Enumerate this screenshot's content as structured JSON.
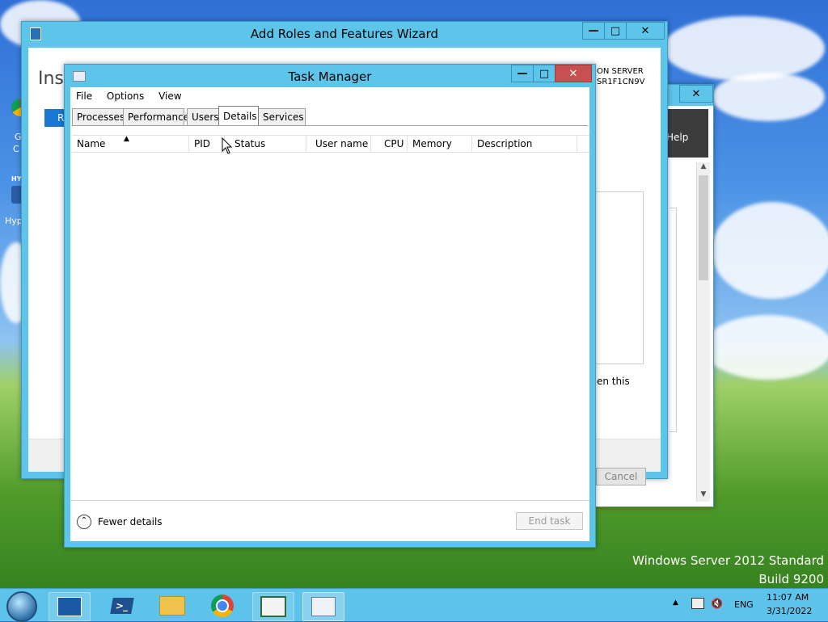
{
  "desktop": {
    "watermark_line1": "Windows Server 2012 Standard",
    "watermark_line2": "Build 9200",
    "icon_labels": [
      "G",
      "C",
      "HY",
      "Hyp"
    ]
  },
  "wizard": {
    "title": "Add Roles and Features Wizard",
    "heading_partial": "Ins",
    "side_button_partial": "R",
    "dest_server_line1": "ON SERVER",
    "dest_server_line2": "SR1F1CN9V",
    "footer_text_partial": "en this",
    "cancel_label": "Cancel",
    "ctl_min": "—",
    "ctl_max": "□",
    "ctl_close": "✕"
  },
  "help_window": {
    "help_label": "Help",
    "close_label": "✕"
  },
  "task_manager": {
    "title": "Task Manager",
    "menu": [
      "File",
      "Options",
      "View"
    ],
    "tabs": [
      "Processes",
      "Performance",
      "Users",
      "Details",
      "Services"
    ],
    "active_tab": "Details",
    "columns": [
      "Name",
      "PID",
      "Status",
      "User name",
      "CPU",
      "Memory (p...",
      "Description"
    ],
    "sort_indicator": "▲",
    "fewer_details_label": "Fewer details",
    "end_task_label": "End task",
    "ctl_min": "—",
    "ctl_max": "□",
    "ctl_close": "✕"
  },
  "taskbar": {
    "icons": [
      "start-orb-icon",
      "server-manager-icon",
      "powershell-icon",
      "file-explorer-icon",
      "chrome-icon",
      "console-icon",
      "task-manager-icon"
    ],
    "tray_lang": "ENG",
    "time": "11:07 AM",
    "date": "3/31/2022",
    "show_hidden_label": "▲"
  }
}
